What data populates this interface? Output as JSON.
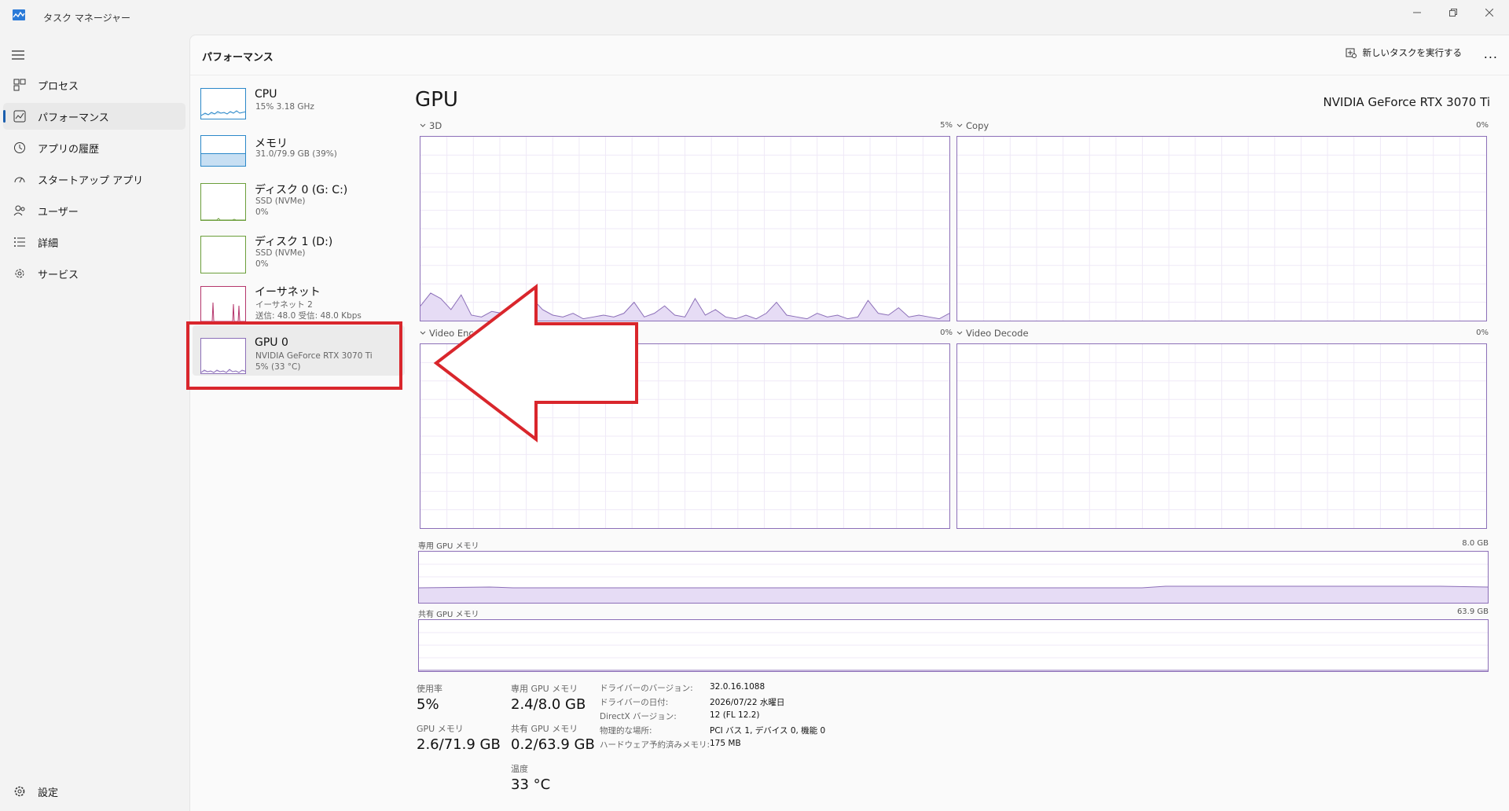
{
  "window": {
    "title": "タスク マネージャー"
  },
  "sidebar": {
    "items": [
      {
        "label": "プロセス",
        "icon": "processes-icon"
      },
      {
        "label": "パフォーマンス",
        "icon": "performance-icon",
        "active": true
      },
      {
        "label": "アプリの履歴",
        "icon": "history-icon"
      },
      {
        "label": "スタートアップ アプリ",
        "icon": "startup-icon"
      },
      {
        "label": "ユーザー",
        "icon": "users-icon"
      },
      {
        "label": "詳細",
        "icon": "details-icon"
      },
      {
        "label": "サービス",
        "icon": "services-icon"
      }
    ],
    "settings_label": "設定"
  },
  "header": {
    "title": "パフォーマンス",
    "run_task_label": "新しいタスクを実行する",
    "more_label": "..."
  },
  "devices": [
    {
      "name": "CPU",
      "sub1": "15%  3.18 GHz",
      "sub2": ""
    },
    {
      "name": "メモリ",
      "sub1": "31.0/79.9 GB (39%)",
      "sub2": ""
    },
    {
      "name": "ディスク 0 (G: C:)",
      "sub1": "SSD (NVMe)",
      "sub2": "0%"
    },
    {
      "name": "ディスク 1 (D:)",
      "sub1": "SSD (NVMe)",
      "sub2": "0%"
    },
    {
      "name": "イーサネット",
      "sub1": "イーサネット 2",
      "sub2": "送信: 48.0  受信: 48.0 Kbps"
    },
    {
      "name": "GPU 0",
      "sub1": "NVIDIA GeForce RTX 3070 Ti",
      "sub2": "5%  (33 °C)",
      "selected": true
    }
  ],
  "gpu": {
    "title": "GPU",
    "model": "NVIDIA GeForce RTX 3070 Ti",
    "engines": [
      {
        "name": "3D",
        "pct": "5%"
      },
      {
        "name": "Copy",
        "pct": "0%"
      },
      {
        "name": "Video Encode",
        "pct": "0%"
      },
      {
        "name": "Video Decode",
        "pct": "0%"
      }
    ],
    "dedicated_mem": {
      "label": "専用 GPU メモリ",
      "max": "8.0 GB"
    },
    "shared_mem": {
      "label": "共有 GPU メモリ",
      "max": "63.9 GB"
    },
    "stats": {
      "utilization_label": "使用率",
      "utilization": "5%",
      "dedicated_label": "専用 GPU メモリ",
      "dedicated": "2.4/8.0 GB",
      "gpu_mem_label": "GPU メモリ",
      "gpu_mem": "2.6/71.9 GB",
      "shared_label": "共有 GPU メモリ",
      "shared": "0.2/63.9 GB",
      "temp_label": "温度",
      "temp": "33 °C"
    },
    "details": [
      {
        "key": "ドライバーのバージョン:",
        "value": "32.0.16.1088"
      },
      {
        "key": "ドライバーの日付:",
        "value": "2026/07/22 水曜日"
      },
      {
        "key": "DirectX バージョン:",
        "value": "12 (FL 12.2)"
      },
      {
        "key": "物理的な場所:",
        "value": "PCI バス 1, デバイス 0, 機能 0"
      },
      {
        "key": "ハードウェア予約済みメモリ:",
        "value": "175 MB"
      }
    ]
  },
  "chart_data": {
    "type": "area",
    "title": "3D",
    "ylim": [
      0,
      100
    ],
    "series": [
      {
        "values": [
          8,
          15,
          12,
          6,
          14,
          3,
          2,
          5,
          4,
          3,
          2,
          12,
          6,
          3,
          2,
          4,
          1,
          2,
          3,
          2,
          4,
          10,
          2,
          4,
          8,
          3,
          2,
          12,
          3,
          6,
          2,
          1,
          3,
          1,
          4,
          10,
          3,
          2,
          1,
          4,
          2,
          3,
          1,
          2,
          11,
          4,
          3,
          7,
          2,
          3,
          2,
          1,
          4
        ]
      }
    ]
  },
  "colors": {
    "accent": "#8c6fb8",
    "fill": "#e6dcf5",
    "annotation": "#d9262c"
  }
}
